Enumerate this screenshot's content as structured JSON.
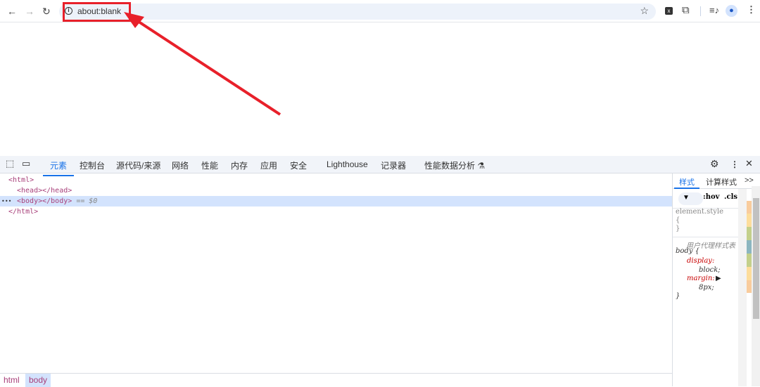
{
  "browser": {
    "url": "about:blank",
    "icons": [
      "back-icon",
      "forward-icon",
      "reload-icon",
      "info-icon",
      "star-icon",
      "extension-x-icon",
      "puzzle-icon",
      "media-icon",
      "profile-icon",
      "menu-icon"
    ]
  },
  "annotation": {
    "color": "#e8202a"
  },
  "devtools": {
    "tabs": [
      "元素",
      "控制台",
      "源代码/来源",
      "网络",
      "性能",
      "内存",
      "应用",
      "安全",
      "Lighthouse",
      "记录器",
      "性能数据分析 ⚗"
    ],
    "active_tab": "元素",
    "dom": {
      "l1": "<html>",
      "l2": "<head></head>",
      "l3": "<body></body>",
      "l3_eq": "== $0",
      "l4": "</html>",
      "dots": "•••"
    },
    "styles": {
      "tab_styles": "样式",
      "tab_computed": "计算样式",
      "more": ">>",
      "hov": ":hov",
      "cls": ".cls",
      "element_style": "element.style",
      "brace_open": "{",
      "brace_close": "}",
      "ua_label": "用户代理样式表",
      "selector": "body {",
      "prop1": "display:",
      "val1": "block;",
      "prop2": "margin:",
      "val2": "8px;",
      "end": "}"
    },
    "breadcrumbs": [
      "html",
      "body"
    ],
    "accent": "#1a73e8"
  }
}
